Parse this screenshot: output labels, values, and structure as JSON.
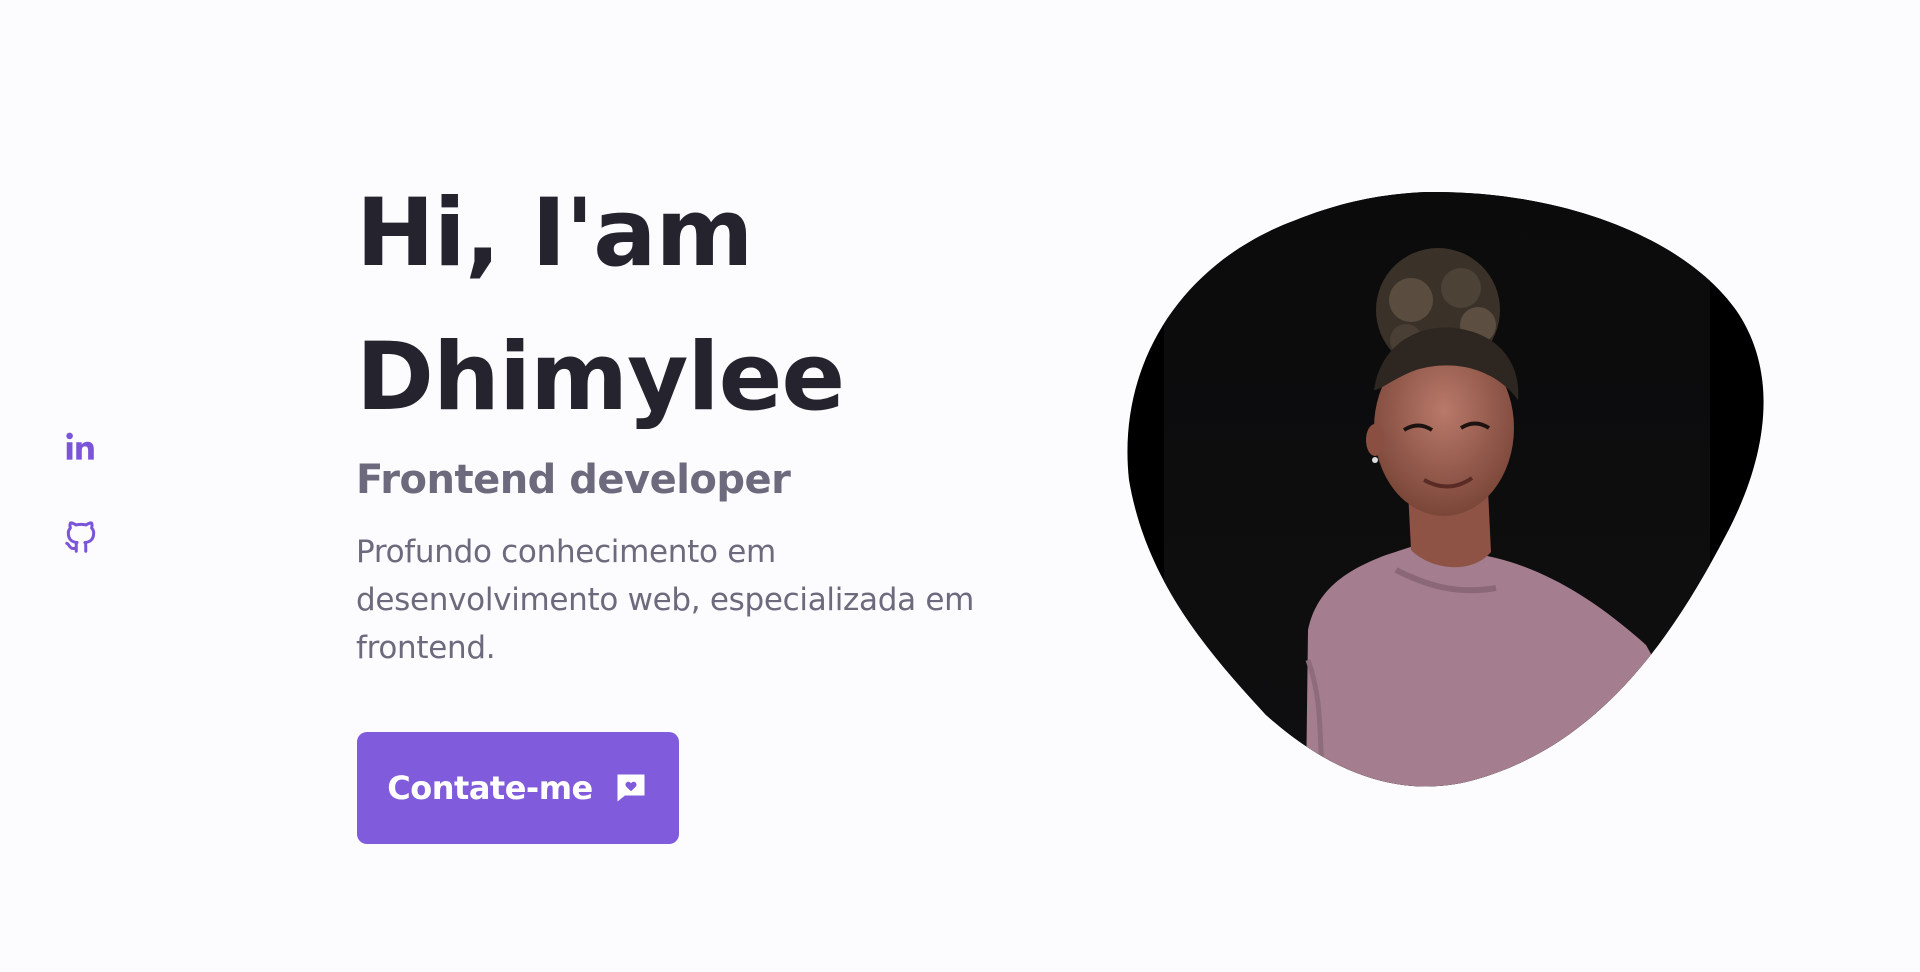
{
  "social": {
    "items": [
      {
        "name": "linkedin",
        "icon": "linkedin-icon"
      },
      {
        "name": "github",
        "icon": "github-icon"
      }
    ]
  },
  "hero": {
    "title_line1": "Hi, I'am",
    "title_line2": "Dhimylee",
    "subtitle": "Frontend developer",
    "description": "Profundo conhecimento em desenvolvimento web, especializada em frontend.",
    "contact_button": {
      "label": "Contate-me",
      "icon": "message-heart-icon"
    }
  },
  "photo": {
    "description_icon": "profile-photo"
  },
  "colors": {
    "background": "#fcfbfe",
    "accent": "#805bdc",
    "icon": "#7b55d8",
    "title": "#25232d",
    "muted_text": "#6c6a7c"
  }
}
